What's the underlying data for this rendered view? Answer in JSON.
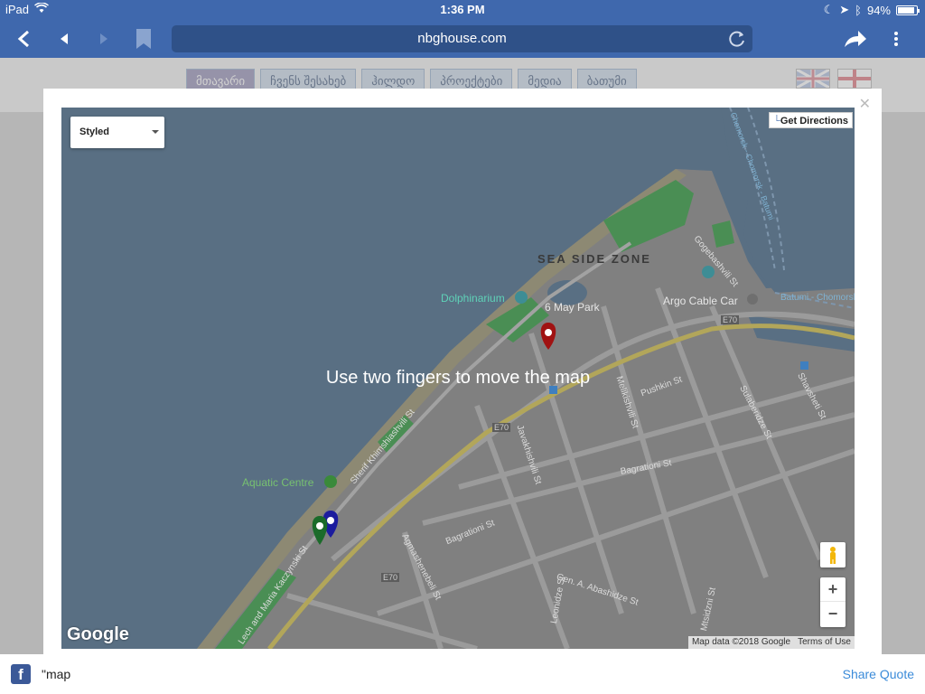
{
  "status": {
    "device": "iPad",
    "time": "1:36 PM",
    "battery": "94%"
  },
  "browser": {
    "url": "nbghouse.com"
  },
  "site": {
    "nav": [
      "მთავარი",
      "ჩვენს შესახებ",
      "ჰილდო",
      "პროექტები",
      "მედია",
      "ბათუმი"
    ]
  },
  "map": {
    "style_select": "Styled",
    "get_directions": "Get Directions",
    "gesture_message": "Use two fingers to move the map",
    "attribution_data": "Map data ©2018 Google",
    "terms": "Terms of Use",
    "logo": "Google",
    "zoom_in": "+",
    "zoom_out": "−",
    "labels": {
      "sea_side_zone": "SEA SIDE ZONE",
      "dolphinarium": "Dolphinarium",
      "may_park": "6 May Park",
      "argo": "Argo Cable Car",
      "aquatic": "Aquatic Centre",
      "e70_a": "E70",
      "e70_b": "E70",
      "e70_c": "E70",
      "gogebashvili": "Gogebashvili St",
      "pushkin": "Pushkin St",
      "melikishvili": "Melikishvili St",
      "javakhishvili": "Javakhishvili St",
      "bagrationi_a": "Bagrationi St",
      "bagrationi_b": "Bagrationi St",
      "agmashenebeli": "Agmashenebeli St",
      "sherif": "Sherif Khimshiashvili St",
      "abashidze": "Gen. A. Abashidze St",
      "leonidze": "Leonidze St",
      "mtsidzni": "Mtsidzni St",
      "sulaberidze": "Sulaberidze St",
      "shavsheti": "Shavsheti St",
      "kaczynski": "Lech and Maria Kaczynski St",
      "chomorsk": "Chomorsk - Chomorsk - Batumi",
      "batumi_ch": "Batumi - Chomorsk"
    }
  },
  "share": {
    "text": "\"map",
    "link": "Share Quote"
  },
  "colors": {
    "browser_blue": "#3f68ad",
    "water": "#596f83",
    "land": "#7f7f7f",
    "park": "#4a8e54",
    "pin_red": "#a01212",
    "pin_blue": "#1c1c9e",
    "pin_green": "#1b6b2a"
  }
}
